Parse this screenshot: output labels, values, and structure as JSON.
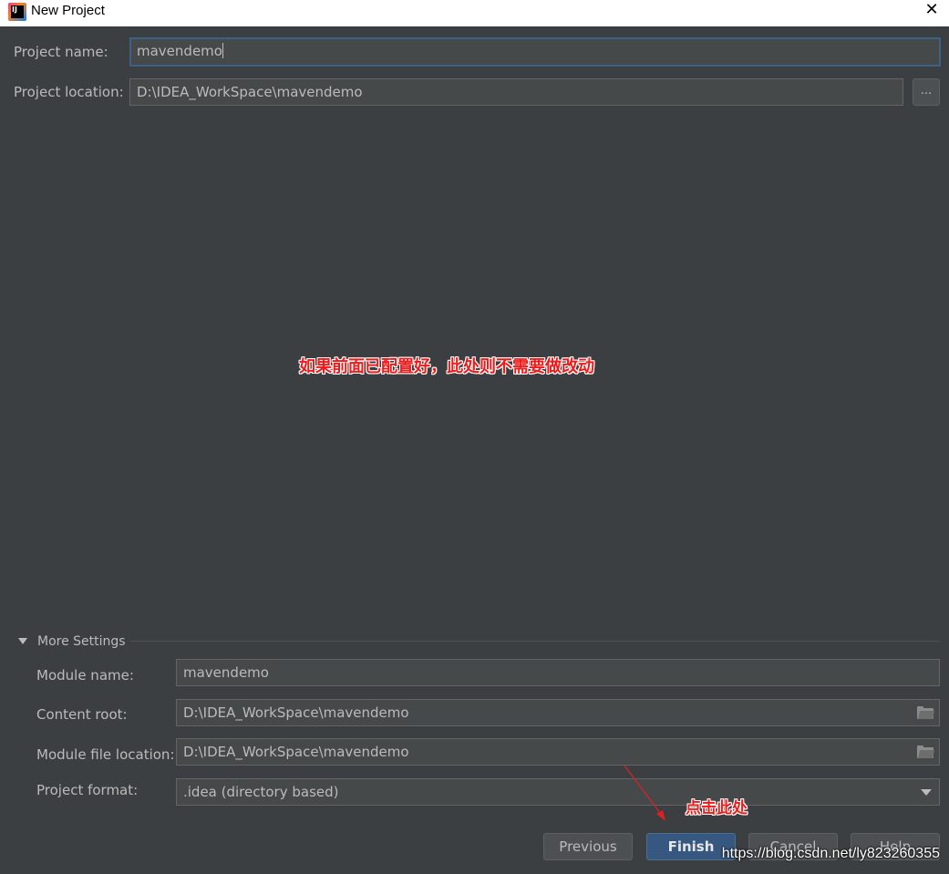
{
  "window": {
    "title": "New Project",
    "close_symbol": "✕",
    "app_icon_text": "IJ",
    "app_icon": "intellij-idea-icon"
  },
  "project": {
    "name_label": "Project name:",
    "name_value": "mavendemo",
    "location_label": "Project location:",
    "location_value": "D:\\IDEA_WorkSpace\\mavendemo",
    "browse_label": "..."
  },
  "more_settings": {
    "header": "More Settings",
    "module_name_label": "Module name:",
    "module_name_value": "mavendemo",
    "content_root_label": "Content root:",
    "content_root_value": "D:\\IDEA_WorkSpace\\mavendemo",
    "module_file_location_label": "Module file location:",
    "module_file_location_value": "D:\\IDEA_WorkSpace\\mavendemo",
    "project_format_label": "Project format:",
    "project_format_value": ".idea (directory based)"
  },
  "buttons": {
    "previous": "Previous",
    "finish": "Finish",
    "cancel": "Cancel",
    "help": "Help"
  },
  "annotations": {
    "center_note": "如果前面已配置好，此处则不需要做改动",
    "click_note": "点击此处",
    "arrow_color": "#e02020",
    "watermark": "https://blog.csdn.net/ly823260355"
  },
  "colors": {
    "background": "#3c3f41",
    "field": "#45494a",
    "focus_border": "#3d6185",
    "primary_button": "#365880"
  }
}
